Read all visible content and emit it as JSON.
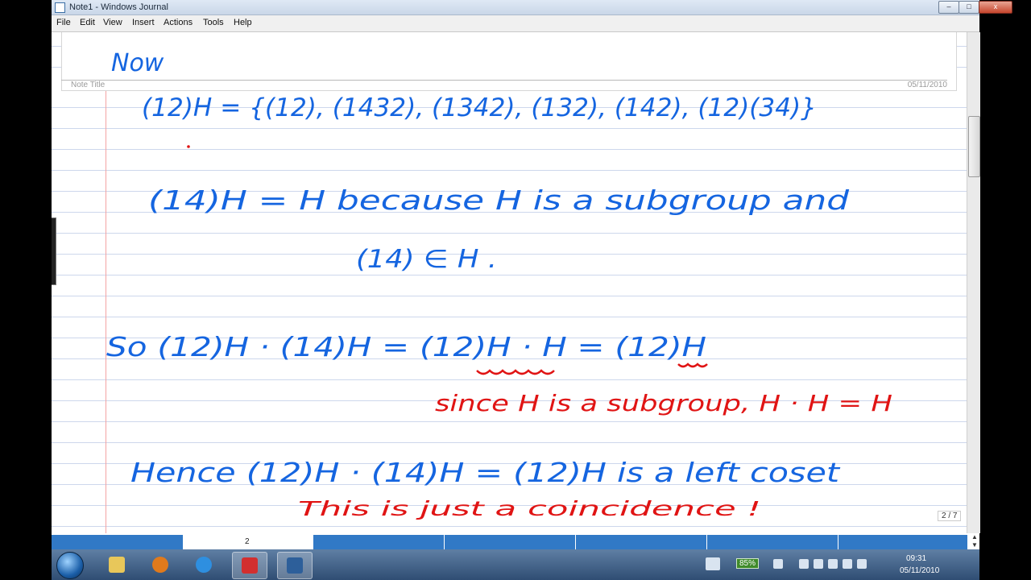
{
  "window": {
    "title": "Note1 - Windows Journal",
    "min_glyph": "–",
    "max_glyph": "□",
    "close_glyph": "x"
  },
  "menu": [
    "File",
    "Edit",
    "View",
    "Insert",
    "Actions",
    "Tools",
    "Help"
  ],
  "note": {
    "title_label": "Note Title",
    "date": "05/11/2010",
    "ink_lines": [
      "Now",
      "(12)H = {(12), (1432), (1342), (132), (142), (12)(34)}",
      "(14)H = H    because   H  is  a  subgroup  and",
      "(14) ∈ H .",
      "So  (12)H · (14)H  =  (12)H · H  = (12)H",
      "since  H  is  a  subgroup,   H · H  =  H",
      "Hence  (12)H · (14)H  =  (12)H  is  a  left  coset",
      "This  is  just  a  coincidence !"
    ]
  },
  "pager": {
    "current_page": "2",
    "indicator": "2 / 7"
  },
  "taskbar": {
    "battery": "85%",
    "time": "09:31",
    "date": "05/11/2010",
    "apps": [
      "explorer-icon",
      "media-player-icon",
      "internet-explorer-icon",
      "pdf-icon",
      "journal-icon"
    ]
  },
  "colors": {
    "ink_blue": "#1565e0",
    "ink_red": "#e01414",
    "accent": "#3179c6"
  }
}
